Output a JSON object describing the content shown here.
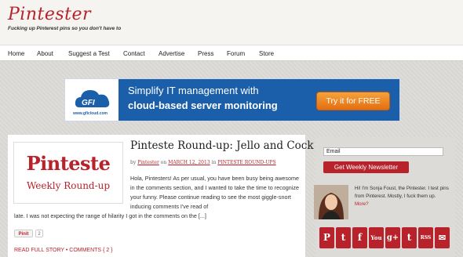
{
  "site": {
    "logo": "Pintester",
    "tagline": "Fucking up Pinterest pins so you don't have to"
  },
  "nav": {
    "items": [
      "Home",
      "About",
      "Suggest a Test",
      "Contact",
      "Advertise",
      "Press",
      "Forum",
      "Store"
    ]
  },
  "ad": {
    "logo_text": "GFI",
    "domain": "www.gficloud.com",
    "line1": "Simplify IT management with",
    "line2": "cloud-based server monitoring",
    "button": "Try it for FREE"
  },
  "post": {
    "thumb_title": "Pinteste",
    "thumb_subtitle": "Weekly Round-up",
    "title": "Pinteste Round-up: Jello and Cock",
    "meta_by": "by",
    "meta_author": "Pintester",
    "meta_on": "on",
    "meta_date": "MARCH 12, 2013",
    "meta_in": "in",
    "meta_category": "PINTESTE ROUND-UPS",
    "body": "Hola, Pintesters! As per usual, you have been busy being awesome in the comments section, and I wanted to take the time to recognize your funny. Please continue reading to see the most giggle-snort inducing comments I've read of",
    "body2": "late. I was not expecting the range of hilarity I got in the comments on the [...]",
    "pinit_label": "Pinit",
    "pin_count": "2",
    "read_more": "READ FULL STORY • COMMENTS { 2 }"
  },
  "sidebar": {
    "email_value": "Email",
    "subscribe_label": "Get Weekly Newsletter",
    "bio": "Hi! I'm Sonja Foust, the Pintester. I test pins from Pinterest. Mostly, I fuck them up.",
    "bio_more": "More?",
    "social": [
      {
        "glyph": "P",
        "icon": "pinterest-icon"
      },
      {
        "glyph": "t",
        "icon": "twitter-icon"
      },
      {
        "glyph": "f",
        "icon": "facebook-icon"
      },
      {
        "glyph": "You",
        "icon": "youtube-icon"
      },
      {
        "glyph": "g+",
        "icon": "google-plus-icon"
      },
      {
        "glyph": "t",
        "icon": "tumblr-icon"
      },
      {
        "glyph": "RSS",
        "icon": "rss-icon"
      },
      {
        "glyph": "✉",
        "icon": "email-icon"
      }
    ]
  },
  "colors": {
    "accent": "#b8222b",
    "ad_blue": "#1b5faa",
    "ad_orange": "#e46e12"
  }
}
